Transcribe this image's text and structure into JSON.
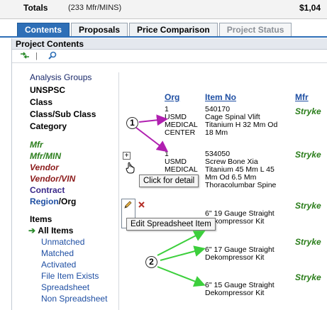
{
  "totals": {
    "label": "Totals",
    "count_text": "(233 Mfr/MINS)",
    "amount": "$1,04"
  },
  "tabs": [
    {
      "label": "Contents",
      "state": "active"
    },
    {
      "label": "Proposals",
      "state": "normal"
    },
    {
      "label": "Price Comparison",
      "state": "normal"
    },
    {
      "label": "Project Status",
      "state": "disabled"
    }
  ],
  "panel": {
    "title": "Project Contents"
  },
  "toolbar": {
    "sep": "|"
  },
  "nav": {
    "groups": [
      "Analysis Groups",
      "UNSPSC",
      "Class",
      "Class/Sub Class",
      "Category"
    ],
    "mfr": "Mfr",
    "mfr_min": "Mfr/MIN",
    "vendor": "Vendor",
    "vendor_vin": "Vendor/VIN",
    "contract": "Contract",
    "region": "Region",
    "org": "/Org",
    "items_heading": "Items",
    "all_items": "All Items",
    "filters": [
      "Unmatched",
      "Matched",
      "Activated",
      "File Item Exists",
      "Spreadsheet",
      "Non Spreadsheet"
    ]
  },
  "grid": {
    "headers": {
      "org": "Org",
      "item_no": "Item No",
      "mfr": "Mfr"
    },
    "rows": [
      {
        "org": [
          "1",
          "USMD",
          "MEDICAL",
          "CENTER"
        ],
        "item": [
          "540170",
          "Cage Spinal Vlift",
          "Titanium H 32 Mm Od",
          "18 Mm"
        ],
        "mfr": "Stryke"
      },
      {
        "org": [
          "1",
          "USMD",
          "MEDICAL"
        ],
        "item": [
          "534050",
          "Screw Bone Xia",
          "Titanium 45 Mm L 45",
          "Mm Od 6.5 Mm",
          "Thoracolumbar Spine"
        ],
        "mfr": "Stryke"
      },
      {
        "org": [],
        "item": [
          "6\" 19 Gauge Straight",
          "Dekompressor Kit"
        ],
        "mfr": "Stryke"
      },
      {
        "org": [],
        "item": [
          "6\" 17 Gauge Straight",
          "Dekompressor Kit"
        ],
        "mfr": "Stryke"
      },
      {
        "org": [],
        "item": [
          "6\" 15 Gauge Straight",
          "Dekompressor Kit"
        ],
        "mfr": "Stryke"
      }
    ]
  },
  "tooltips": {
    "detail": "Click for detail",
    "edit": "Edit Spreadsheet Item"
  },
  "expand_symbol": "+",
  "callouts": [
    "1",
    "2"
  ],
  "icons": {
    "refresh": "refresh-arrows-icon",
    "search": "search-icon",
    "pencil": "pencil-icon",
    "delete": "delete-x-icon",
    "hand": "hand-cursor-icon",
    "arrow": "green-arrow-icon"
  },
  "colors": {
    "tab_active": "#2e6fb7",
    "mfr_green": "#2a7d1a",
    "vendor_red": "#8b1a1a",
    "callout_arrow_purple": "#b020b0",
    "callout_arrow_green": "#3ccf3c"
  }
}
